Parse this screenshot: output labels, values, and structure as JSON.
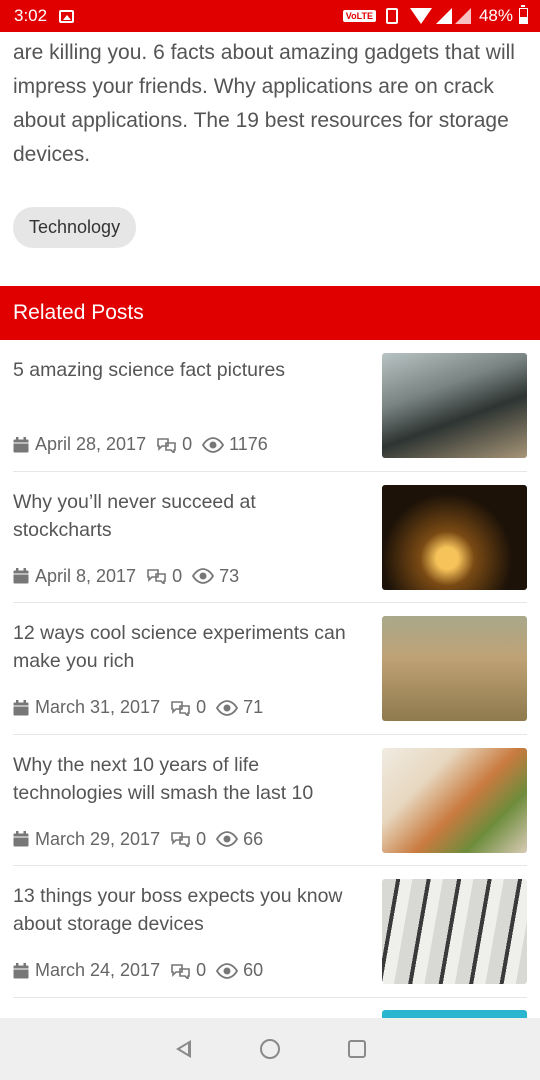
{
  "status_bar": {
    "time": "3:02",
    "volte": "VoLTE",
    "battery": "48%"
  },
  "article": {
    "tail_text": "are killing you. 6 facts about amazing gadgets that will impress your friends. Why applications are on crack about applications. The 19 best resources for storage devices.",
    "tag": "Technology"
  },
  "related": {
    "header": "Related Posts",
    "posts": [
      {
        "title": "5 amazing science fact pictures",
        "date": "April 28, 2017",
        "comments": "0",
        "views": "1176",
        "image": "typewriter"
      },
      {
        "title": "Why you’ll never succeed at stockcharts",
        "date": "April 8, 2017",
        "comments": "0",
        "views": "73",
        "image": "lightbulbs"
      },
      {
        "title": "12 ways cool science experiments can make you rich",
        "date": "March 31, 2017",
        "comments": "0",
        "views": "71",
        "image": "woman-field"
      },
      {
        "title": "Why the next 10 years of life technologies will smash the last 10",
        "date": "March 29, 2017",
        "comments": "0",
        "views": "66",
        "image": "sandwich"
      },
      {
        "title": "13 things your boss expects you know about storage devices",
        "date": "March 24, 2017",
        "comments": "0",
        "views": "60",
        "image": "keyboard-keys"
      }
    ]
  },
  "colors": {
    "accent": "#e00000",
    "text": "#555555",
    "tag_bg": "#e6e6e6"
  },
  "icons": [
    "image-icon",
    "vibrate-icon",
    "wifi-icon",
    "signal-icon",
    "battery-icon",
    "calendar-icon",
    "comment-icon",
    "eye-icon",
    "back-icon",
    "home-icon",
    "recents-icon"
  ]
}
